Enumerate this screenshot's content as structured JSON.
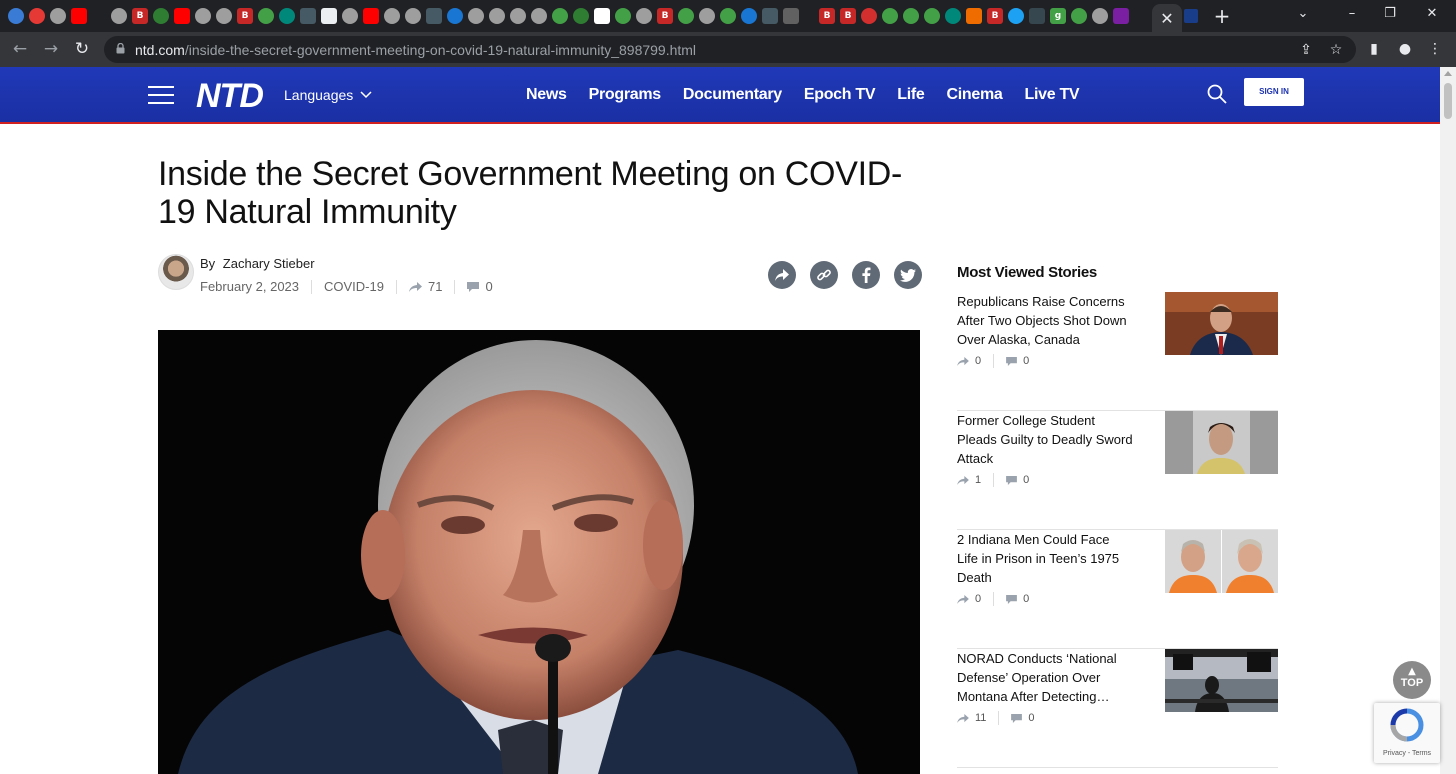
{
  "browser": {
    "active_tab_close": "✕",
    "new_tab": "+",
    "url_domain": "ntd.com",
    "url_path": "/inside-the-secret-government-meeting-on-covid-19-natural-immunity_898799.html"
  },
  "site": {
    "logo": "NTD",
    "languages_label": "Languages",
    "nav": [
      "News",
      "Programs",
      "Documentary",
      "Epoch TV",
      "Life",
      "Cinema",
      "Live TV"
    ],
    "signin_label": "SIGN IN",
    "brand_color": "#1d33b0"
  },
  "article": {
    "headline": "Inside the Secret Government Meeting on COVID-19 Natural Immunity",
    "by_label": "By",
    "author": "Zachary Stieber",
    "date": "February 2, 2023",
    "category": "COVID-19",
    "shares": "71",
    "comments": "0"
  },
  "sidebar": {
    "title": "Most Viewed Stories",
    "stories": [
      {
        "title": "Republicans Raise Concerns After Two Objects Shot Down Over Alaska, Canada",
        "shares": "0",
        "comments": "0"
      },
      {
        "title": "Former College Student Pleads Guilty to Deadly Sword Attack",
        "shares": "1",
        "comments": "0"
      },
      {
        "title": "2 Indiana Men Could Face Life in Prison in Teen’s 1975 Death",
        "shares": "0",
        "comments": "0"
      },
      {
        "title": "NORAD Conducts ‘National Defense’ Operation Over Montana After Detecting…",
        "shares": "11",
        "comments": "0"
      }
    ]
  },
  "scroll_to_top_label": "TOP",
  "recaptcha_text": "Privacy - Terms"
}
